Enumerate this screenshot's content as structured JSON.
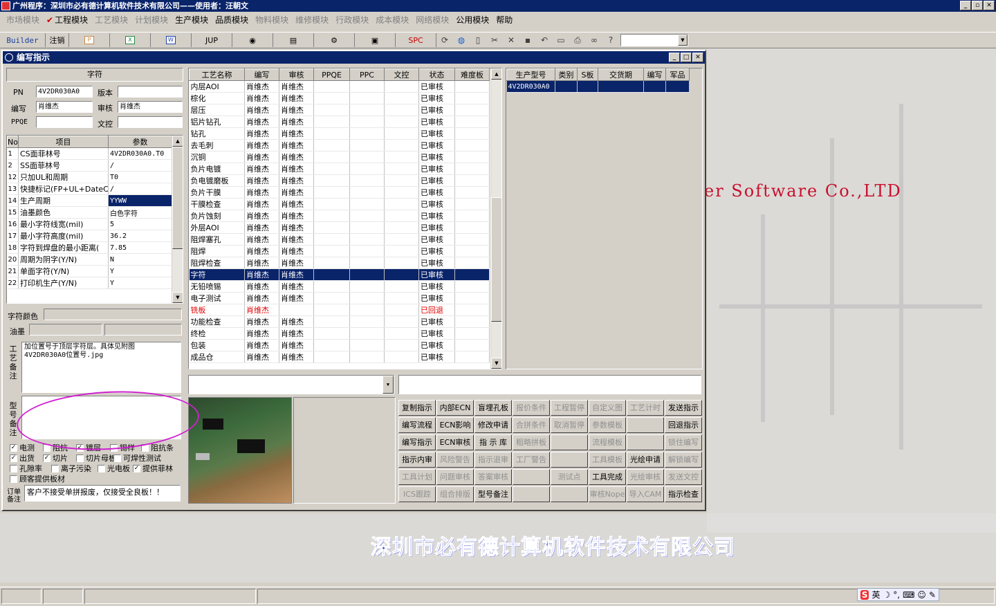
{
  "titlebar": {
    "title": "广州程序：深圳市必有德计算机软件技术有限公司——使用者：汪朝文"
  },
  "menubar": [
    {
      "label": "市场模块",
      "enabled": false
    },
    {
      "label": "工程模块",
      "enabled": true,
      "checked": true
    },
    {
      "label": "工艺模块",
      "enabled": false
    },
    {
      "label": "计划模块",
      "enabled": false
    },
    {
      "label": "生产模块",
      "enabled": true
    },
    {
      "label": "品质模块",
      "enabled": true
    },
    {
      "label": "物料模块",
      "enabled": false
    },
    {
      "label": "维修模块",
      "enabled": false
    },
    {
      "label": "行政模块",
      "enabled": false
    },
    {
      "label": "成本模块",
      "enabled": false
    },
    {
      "label": "网络模块",
      "enabled": false
    },
    {
      "label": "公用模块",
      "enabled": true
    },
    {
      "label": "帮助",
      "enabled": true
    }
  ],
  "toolbar": {
    "builder": "Builder",
    "logout": "注销",
    "jup": "JUP",
    "spc": "SPC"
  },
  "background": {
    "english": "er  Software  Co.,LTD",
    "chinese": "深圳市必有德计算机软件技术有限公司"
  },
  "dialog": {
    "title": "编写指示",
    "section_title": "字符",
    "fields": {
      "pn_label": "PN",
      "pn_value": "4V2DR030A0",
      "version_label": "版本",
      "version_value": "",
      "writer_label": "编写",
      "writer_value": "肖维杰",
      "review_label": "审核",
      "review_value": "肖维杰",
      "ppqe_label": "PPQE",
      "ppqe_value": "",
      "doc_control_label": "文控",
      "doc_control_value": ""
    },
    "params_table": {
      "headers": [
        "No",
        "项目",
        "参数"
      ],
      "rows": [
        [
          "1",
          "CS面菲林号",
          "4V2DR030A0.T0",
          false
        ],
        [
          "2",
          "SS面菲林号",
          "/",
          false
        ],
        [
          "12",
          "只加UL和周期",
          "T0",
          false
        ],
        [
          "13",
          "快捷标记(FP+UL+DateCo",
          "/",
          false
        ],
        [
          "14",
          "生产周期",
          "YYWW",
          true
        ],
        [
          "15",
          "油墨颜色",
          "白色字符",
          false
        ],
        [
          "16",
          "最小字符线宽(mil)",
          "5",
          false
        ],
        [
          "17",
          "最小字符高度(mil)",
          "36.2",
          false
        ],
        [
          "18",
          "字符到焊盘的最小距离(",
          "7.85",
          false
        ],
        [
          "20",
          "周期为阴字(Y/N)",
          "N",
          false
        ],
        [
          "21",
          "单面字符(Y/N)",
          "Y",
          false
        ],
        [
          "22",
          "打印机生产(Y/N)",
          "Y",
          false
        ]
      ]
    },
    "char_color_label": "字符颜色",
    "char_color_value": "",
    "ink_label": "油墨",
    "process_note_label": "工艺备注",
    "process_note": "加位置号于顶层字符层。具体见附图\n4V2DR030A0位置号.jpg",
    "model_note_label": "型号备注",
    "model_note": "",
    "checkboxes": [
      {
        "label": "电测",
        "checked": true
      },
      {
        "label": "阻抗",
        "checked": false
      },
      {
        "label": "镀层",
        "checked": true
      },
      {
        "label": "锡样",
        "checked": false
      },
      {
        "label": "阻抗条",
        "checked": false
      },
      {
        "label": "出货",
        "checked": true
      },
      {
        "label": "切片",
        "checked": true
      },
      {
        "label": "切片母板",
        "checked": false
      },
      {
        "label": "可焊性测试",
        "checked": false
      },
      {
        "label": "孔隙率",
        "checked": false
      },
      {
        "label": "离子污染",
        "checked": false
      },
      {
        "label": "光电板",
        "checked": false
      },
      {
        "label": "提供菲林",
        "checked": true
      },
      {
        "label": "顾客提供板材",
        "checked": false
      }
    ],
    "order_note_label": "订单备注",
    "order_note": "客户不接受单拼报废，仅接受全良板！！",
    "process_table": {
      "headers": [
        "工艺名称",
        "编写",
        "审核",
        "PPQE",
        "PPC",
        "文控",
        "状态",
        "难度板"
      ],
      "rows": [
        [
          "内层AOI",
          "肖维杰",
          "肖维杰",
          "",
          "",
          "",
          "已审核",
          "",
          "normal"
        ],
        [
          "棕化",
          "肖维杰",
          "肖维杰",
          "",
          "",
          "",
          "已审核",
          "",
          "normal"
        ],
        [
          "层压",
          "肖维杰",
          "肖维杰",
          "",
          "",
          "",
          "已审核",
          "",
          "normal"
        ],
        [
          "铝片钻孔",
          "肖维杰",
          "肖维杰",
          "",
          "",
          "",
          "已审核",
          "",
          "normal"
        ],
        [
          "钻孔",
          "肖维杰",
          "肖维杰",
          "",
          "",
          "",
          "已审核",
          "",
          "normal"
        ],
        [
          "去毛刺",
          "肖维杰",
          "肖维杰",
          "",
          "",
          "",
          "已审核",
          "",
          "normal"
        ],
        [
          "沉铜",
          "肖维杰",
          "肖维杰",
          "",
          "",
          "",
          "已审核",
          "",
          "normal"
        ],
        [
          "负片电镀",
          "肖维杰",
          "肖维杰",
          "",
          "",
          "",
          "已审核",
          "",
          "normal"
        ],
        [
          "负电镀磨板",
          "肖维杰",
          "肖维杰",
          "",
          "",
          "",
          "已审核",
          "",
          "normal"
        ],
        [
          "负片干膜",
          "肖维杰",
          "肖维杰",
          "",
          "",
          "",
          "已审核",
          "",
          "normal"
        ],
        [
          "干膜检查",
          "肖维杰",
          "肖维杰",
          "",
          "",
          "",
          "已审核",
          "",
          "normal"
        ],
        [
          "负片蚀刻",
          "肖维杰",
          "肖维杰",
          "",
          "",
          "",
          "已审核",
          "",
          "normal"
        ],
        [
          "外层AOI",
          "肖维杰",
          "肖维杰",
          "",
          "",
          "",
          "已审核",
          "",
          "normal"
        ],
        [
          "阻焊塞孔",
          "肖维杰",
          "肖维杰",
          "",
          "",
          "",
          "已审核",
          "",
          "normal"
        ],
        [
          "阻焊",
          "肖维杰",
          "肖维杰",
          "",
          "",
          "",
          "已审核",
          "",
          "normal"
        ],
        [
          "阻焊检查",
          "肖维杰",
          "肖维杰",
          "",
          "",
          "",
          "已审核",
          "",
          "normal"
        ],
        [
          "字符",
          "肖维杰",
          "肖维杰",
          "",
          "",
          "",
          "已审核",
          "",
          "selected"
        ],
        [
          "无铅喷锡",
          "肖维杰",
          "肖维杰",
          "",
          "",
          "",
          "已审核",
          "",
          "normal"
        ],
        [
          "电子测试",
          "肖维杰",
          "肖维杰",
          "",
          "",
          "",
          "已审核",
          "",
          "normal"
        ],
        [
          "铣板",
          "肖维杰",
          "",
          "",
          "",
          "",
          "已回退",
          "",
          "red"
        ],
        [
          "功能检查",
          "肖维杰",
          "肖维杰",
          "",
          "",
          "",
          "已审核",
          "",
          "normal"
        ],
        [
          "终检",
          "肖维杰",
          "肖维杰",
          "",
          "",
          "",
          "已审核",
          "",
          "normal"
        ],
        [
          "包装",
          "肖维杰",
          "肖维杰",
          "",
          "",
          "",
          "已审核",
          "",
          "normal"
        ],
        [
          "成品仓",
          "肖维杰",
          "肖维杰",
          "",
          "",
          "",
          "已审核",
          "",
          "normal"
        ]
      ]
    },
    "model_table": {
      "headers": [
        "生产型号",
        "类别",
        "S板",
        "交货期",
        "编写",
        "军品"
      ],
      "rows": [
        [
          "4V2DR030A0",
          "",
          "",
          "",
          "",
          ""
        ]
      ]
    },
    "buttons": [
      [
        {
          "label": "复制指示",
          "enabled": true
        },
        {
          "label": "内部ECN",
          "enabled": true
        },
        {
          "label": "盲埋孔板",
          "enabled": true
        },
        {
          "label": "报价条件",
          "enabled": false
        },
        {
          "label": "工程暂停",
          "enabled": false
        },
        {
          "label": "自定义图",
          "enabled": false
        },
        {
          "label": "工艺计时",
          "enabled": false
        },
        {
          "label": "发送指示",
          "enabled": true
        }
      ],
      [
        {
          "label": "编写流程",
          "enabled": true
        },
        {
          "label": "ECN影响",
          "enabled": true
        },
        {
          "label": "修改申请",
          "enabled": true
        },
        {
          "label": "合拼条件",
          "enabled": false
        },
        {
          "label": "取消暂停",
          "enabled": false
        },
        {
          "label": "参数模板",
          "enabled": false
        },
        {
          "label": "",
          "enabled": false
        },
        {
          "label": "回退指示",
          "enabled": true
        }
      ],
      [
        {
          "label": "编写指示",
          "enabled": true
        },
        {
          "label": "ECN审核",
          "enabled": true
        },
        {
          "label": "指 示 库",
          "enabled": true
        },
        {
          "label": "粗略拼板",
          "enabled": false
        },
        {
          "label": "",
          "enabled": false
        },
        {
          "label": "流程模板",
          "enabled": false
        },
        {
          "label": "",
          "enabled": false
        },
        {
          "label": "锁住编写",
          "enabled": false
        }
      ],
      [
        {
          "label": "指示内审",
          "enabled": true
        },
        {
          "label": "风险警告",
          "enabled": false
        },
        {
          "label": "指示退审",
          "enabled": false
        },
        {
          "label": "工厂警告",
          "enabled": false
        },
        {
          "label": "",
          "enabled": false
        },
        {
          "label": "工具模板",
          "enabled": false
        },
        {
          "label": "光绘申请",
          "enabled": true
        },
        {
          "label": "解锁编写",
          "enabled": false
        }
      ],
      [
        {
          "label": "工具计划",
          "enabled": false
        },
        {
          "label": "问题审核",
          "enabled": false
        },
        {
          "label": "答案审核",
          "enabled": false
        },
        {
          "label": "",
          "enabled": false
        },
        {
          "label": "测试点",
          "enabled": false
        },
        {
          "label": "工具完成",
          "enabled": true
        },
        {
          "label": "光绘审核",
          "enabled": false
        },
        {
          "label": "发送文控",
          "enabled": false
        }
      ],
      [
        {
          "label": "ICS跟踪",
          "enabled": false
        },
        {
          "label": "组合排版",
          "enabled": false
        },
        {
          "label": "型号备注",
          "enabled": true
        },
        {
          "label": "",
          "enabled": false
        },
        {
          "label": "",
          "enabled": false
        },
        {
          "label": "审核Nope",
          "enabled": false
        },
        {
          "label": "导入CAM",
          "enabled": false
        },
        {
          "label": "指示检查",
          "enabled": true
        }
      ]
    ]
  },
  "ime": {
    "mode": "英"
  },
  "colors": {
    "titlebar": "#0a246a",
    "selection": "#0a246a",
    "brand_red": "#c8102e",
    "brand_blue": "#3a46e0",
    "annotation": "#d020d0"
  }
}
